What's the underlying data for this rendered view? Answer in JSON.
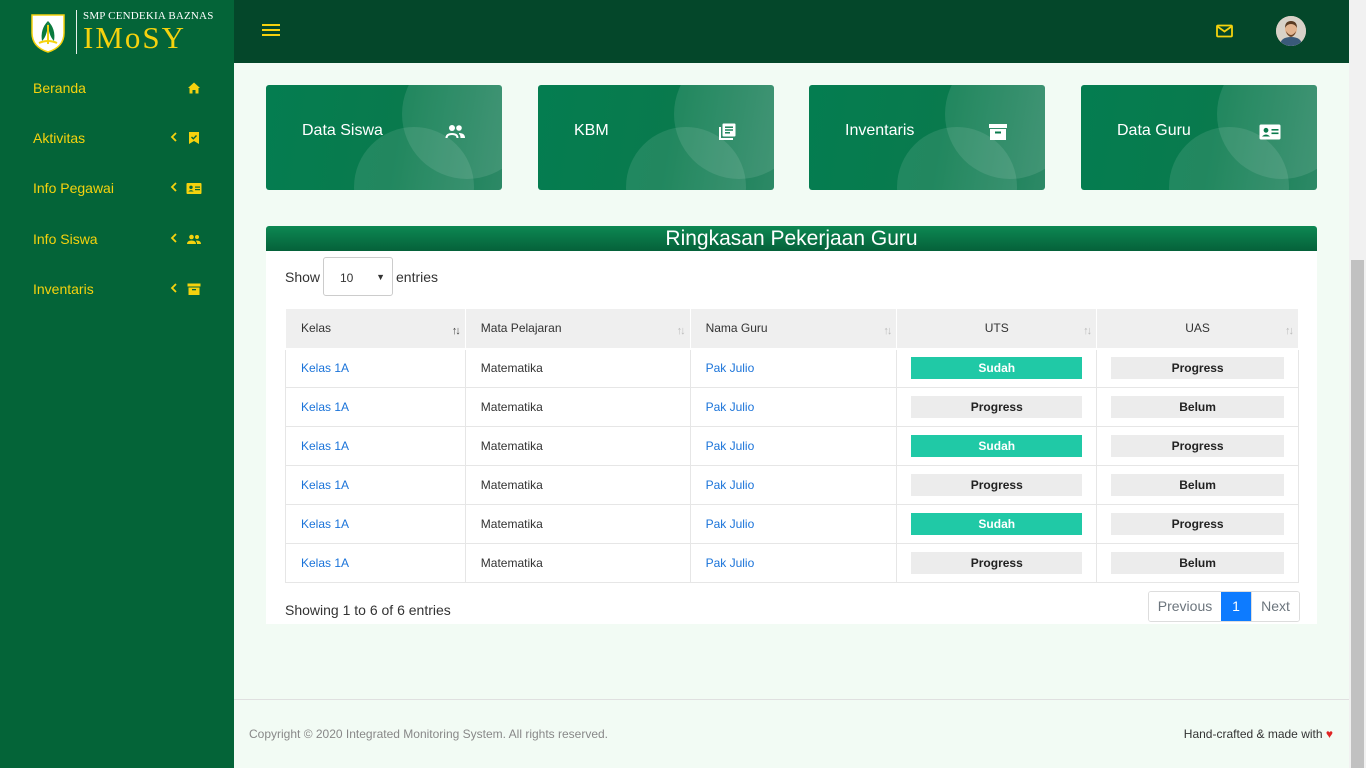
{
  "brand": {
    "school": "SMP CENDEKIA BAZNAS",
    "app": "IMoSY"
  },
  "sidebar": {
    "items": [
      {
        "label": "Beranda",
        "icon": "home-icon",
        "expandable": false
      },
      {
        "label": "Aktivitas",
        "icon": "bookmark-check-icon",
        "expandable": true
      },
      {
        "label": "Info Pegawai",
        "icon": "id-card-icon",
        "expandable": true
      },
      {
        "label": "Info Siswa",
        "icon": "people-icon",
        "expandable": true
      },
      {
        "label": "Inventaris",
        "icon": "archive-icon",
        "expandable": true
      }
    ]
  },
  "cards": [
    {
      "label": "Data Siswa",
      "icon": "people-icon"
    },
    {
      "label": "KBM",
      "icon": "library-books-icon"
    },
    {
      "label": "Inventaris",
      "icon": "archive-icon"
    },
    {
      "label": "Data Guru",
      "icon": "id-card-icon"
    }
  ],
  "panel": {
    "title": "Ringkasan Pekerjaan Guru",
    "show_label": "Show",
    "entries_label": "entries",
    "page_size": "10",
    "columns": [
      "Kelas",
      "Mata Pelajaran",
      "Nama Guru",
      "UTS",
      "UAS"
    ],
    "rows": [
      {
        "kelas": "Kelas 1A",
        "mapel": "Matematika",
        "guru": "Pak Julio",
        "uts": "Sudah",
        "uas": "Progress"
      },
      {
        "kelas": "Kelas 1A",
        "mapel": "Matematika",
        "guru": "Pak Julio",
        "uts": "Progress",
        "uas": "Belum"
      },
      {
        "kelas": "Kelas 1A",
        "mapel": "Matematika",
        "guru": "Pak Julio",
        "uts": "Sudah",
        "uas": "Progress"
      },
      {
        "kelas": "Kelas 1A",
        "mapel": "Matematika",
        "guru": "Pak Julio",
        "uts": "Progress",
        "uas": "Belum"
      },
      {
        "kelas": "Kelas 1A",
        "mapel": "Matematika",
        "guru": "Pak Julio",
        "uts": "Sudah",
        "uas": "Progress"
      },
      {
        "kelas": "Kelas 1A",
        "mapel": "Matematika",
        "guru": "Pak Julio",
        "uts": "Progress",
        "uas": "Belum"
      }
    ],
    "info": "Showing 1 to 6 of 6 entries",
    "pager": {
      "prev": "Previous",
      "current": "1",
      "next": "Next"
    }
  },
  "footer": {
    "copyright": "Copyright © 2020 Integrated Monitoring System. All rights reserved.",
    "made_with": "Hand-crafted & made with"
  },
  "colors": {
    "sidebar": "#046438",
    "topbar": "#04472a",
    "accent": "#f5d20e",
    "sudah": "#20c9a6",
    "link": "#1a73d9"
  }
}
